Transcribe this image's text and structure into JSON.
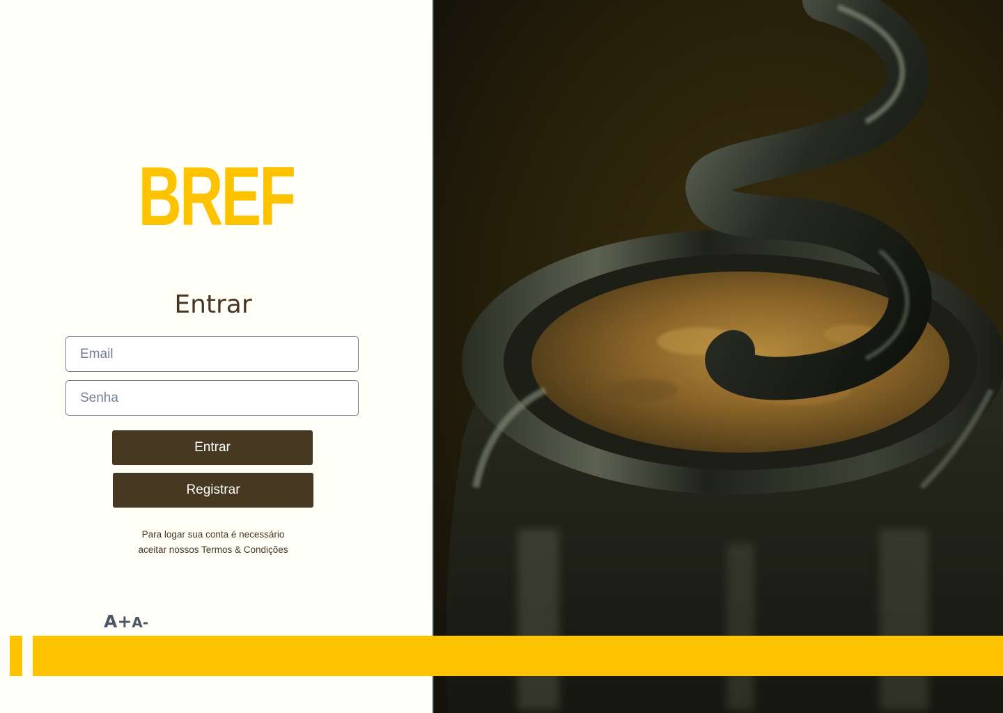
{
  "brand": {
    "logo_text": "BREF",
    "accent_color": "#fdc300",
    "primary_color": "#473822"
  },
  "login_form": {
    "title": "Entrar",
    "email_placeholder": "Email",
    "email_value": "",
    "password_placeholder": "Senha",
    "password_value": "",
    "submit_label": "Entrar",
    "register_label": "Registrar",
    "terms_line1": "Para logar sua conta é necessário",
    "terms_line2": "aceitar nossos Termos & Condições"
  },
  "accessibility": {
    "font_increase_label": "A+",
    "font_decrease_label": "A-"
  },
  "hero": {
    "icon": "corkscrew-wine-bottle-photo"
  }
}
